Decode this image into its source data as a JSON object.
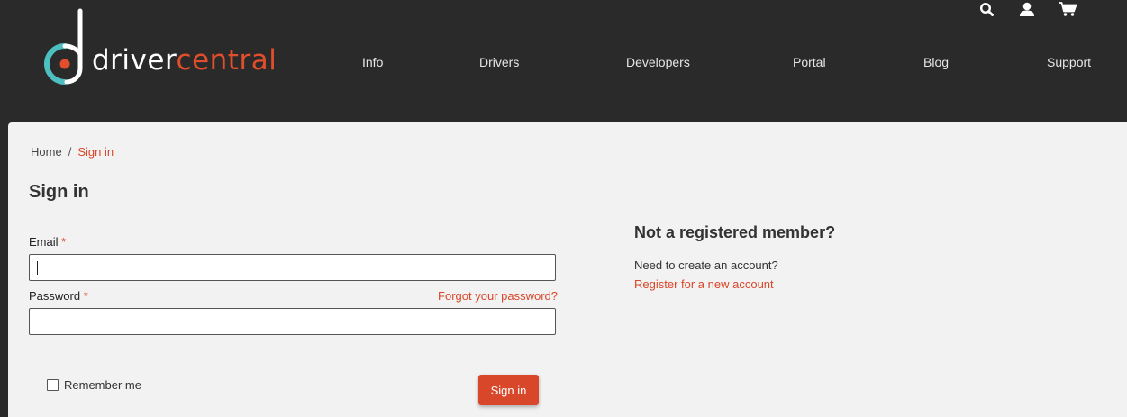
{
  "header": {
    "logo": {
      "part1": "driver",
      "part2": "central"
    },
    "nav": [
      {
        "label": "Info"
      },
      {
        "label": "Drivers"
      },
      {
        "label": "Developers"
      },
      {
        "label": "Portal"
      },
      {
        "label": "Blog"
      },
      {
        "label": "Support"
      }
    ],
    "icons": [
      "search-icon",
      "user-icon",
      "cart-icon"
    ]
  },
  "breadcrumb": {
    "home": "Home",
    "separator": "/",
    "current": "Sign in"
  },
  "form": {
    "title": "Sign in",
    "email_label": "Email",
    "password_label": "Password",
    "required_mark": "*",
    "email_value": "",
    "password_value": "",
    "forgot_link": "Forgot your password?",
    "remember_label": "Remember me",
    "remember_checked": false,
    "submit_label": "Sign in"
  },
  "register": {
    "title": "Not a registered member?",
    "text": "Need to create an account?",
    "link": "Register for a new account"
  },
  "colors": {
    "header_bg": "#2a2a2a",
    "content_bg": "#f2f2f2",
    "accent": "#d9472b",
    "logo_teal": "#4dbfc0"
  }
}
